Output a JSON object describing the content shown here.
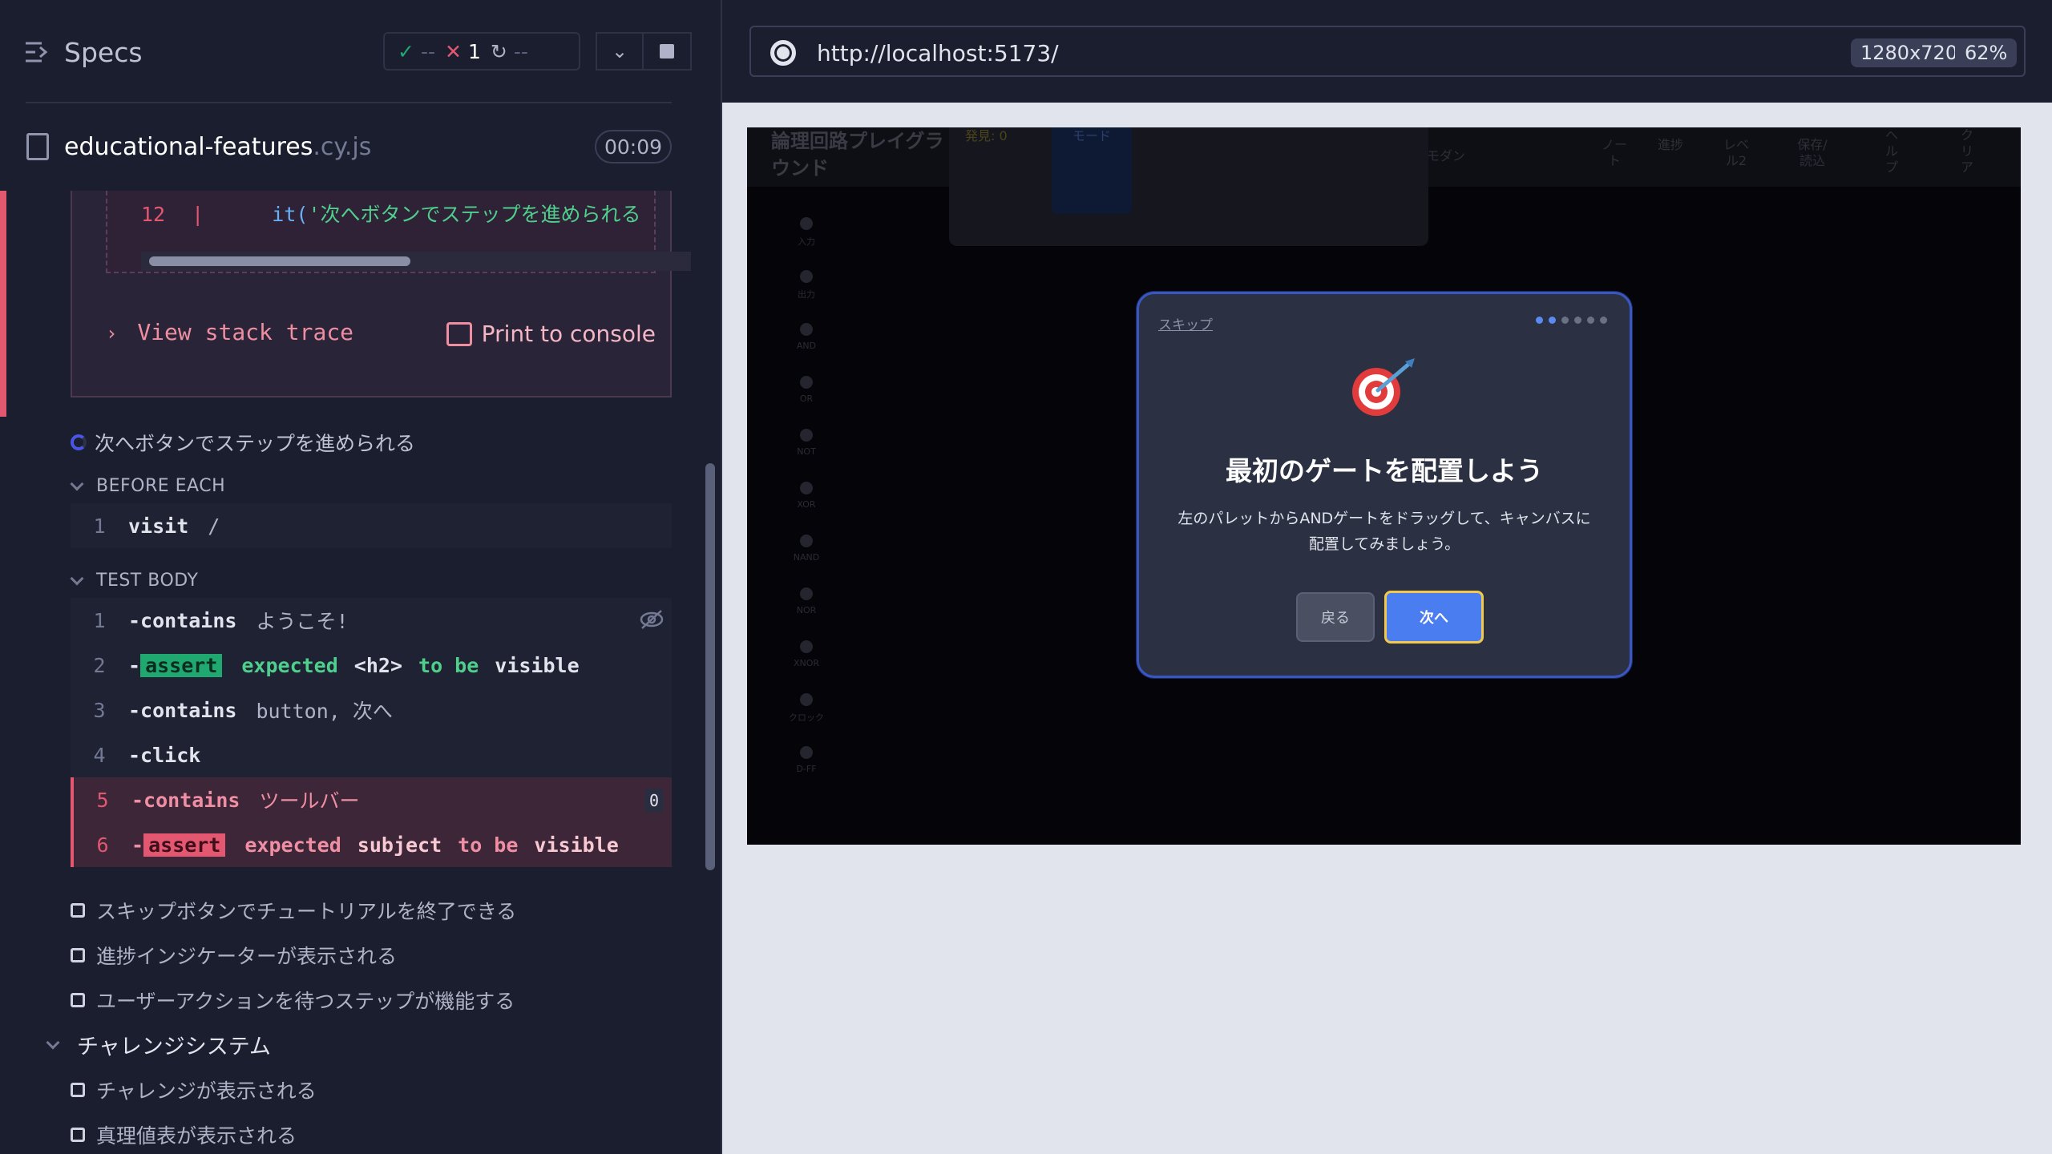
{
  "sidebar": {
    "title": "Specs",
    "stats": {
      "passed": "--",
      "failed": "1",
      "pending": "--"
    }
  },
  "file": {
    "name": "educational-features",
    "ext": ".cy.js",
    "duration": "00:09"
  },
  "error": {
    "line_number": "12",
    "line_sep": "|",
    "code_prefix": "it(",
    "code_string": "'次へボタンでステップを進められる",
    "stack_label": "View stack trace",
    "print_label": "Print to console"
  },
  "test": {
    "title": "次へボタンでステップを進められる",
    "before_each_label": "BEFORE EACH",
    "test_body_label": "TEST BODY",
    "before_each": [
      {
        "num": "1",
        "name": "visit",
        "msg": "/"
      }
    ],
    "commands": [
      {
        "num": "1",
        "name": "-contains",
        "msg": "ようこそ!"
      },
      {
        "num": "2",
        "name": "-",
        "badge": "assert",
        "parts": [
          "expected",
          "<h2>",
          "to be",
          "visible"
        ]
      },
      {
        "num": "3",
        "name": "-contains",
        "msg": "button, 次へ"
      },
      {
        "num": "4",
        "name": "-click",
        "msg": ""
      },
      {
        "num": "5",
        "name": "-contains",
        "msg": "ツールバー",
        "count": "0"
      },
      {
        "num": "6",
        "name": "-",
        "badge": "assert",
        "parts": [
          "expected",
          "subject",
          "to be",
          "visible"
        ]
      }
    ]
  },
  "pending_tests": [
    "スキップボタンでチュートリアルを終了できる",
    "進捗インジケーターが表示される",
    "ユーザーアクションを待つステップが機能する"
  ],
  "suite": {
    "title": "チャレンジシステム",
    "tests": [
      "チャレンジが表示される",
      "真理値表が表示される"
    ]
  },
  "browser": {
    "url": "http://localhost:5173/",
    "viewport": "1280x720",
    "zoom": "62%"
  },
  "app": {
    "title": "論理回路プレイグラウンド",
    "toolbar": [
      "モダン",
      "ノート",
      "進捗",
      "レベル2",
      "保存/読込",
      "ヘルプ",
      "クリア"
    ],
    "panel_yellow": "発見: 0",
    "panel_blue": "モード",
    "palette": [
      "入力",
      "出力",
      "AND",
      "OR",
      "NOT",
      "XOR",
      "NAND",
      "NOR",
      "XNOR",
      "クロック",
      "D-FF"
    ]
  },
  "modal": {
    "skip": "スキップ",
    "step_current": 2,
    "step_total": 6,
    "emoji": "🎯",
    "title": "最初のゲートを配置しよう",
    "description": "左のパレットからANDゲートをドラッグして、キャンバスに配置してみましょう。",
    "back": "戻る",
    "next": "次へ"
  },
  "colors": {
    "accent": "#4956e3",
    "fail": "#e45770",
    "pass": "#1fa971",
    "modal_next": "#4a7df0"
  }
}
